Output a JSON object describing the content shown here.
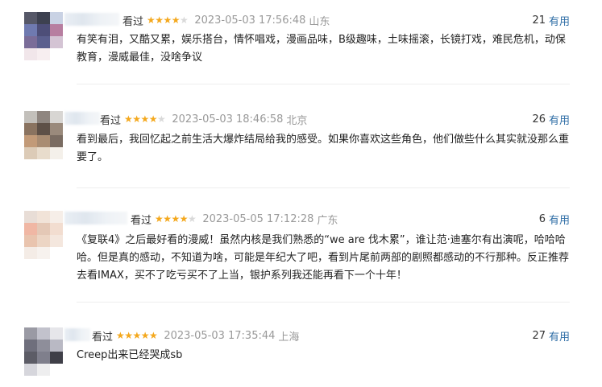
{
  "comments": [
    {
      "seen_label": "看过",
      "stars": 4,
      "time": "2023-05-03 17:56:48",
      "location": "山东",
      "useful_count": "21",
      "useful_label": "有用",
      "text": "有笑有泪，又酷又累，娱乐搭台，情怀唱戏，漫画品味，B级趣味，土味摇滚，长镜打戏，难民危机，动保教育，漫威最佳，没啥争议"
    },
    {
      "seen_label": "看过",
      "stars": 4,
      "time": "2023-05-03 18:46:58",
      "location": "北京",
      "useful_count": "26",
      "useful_label": "有用",
      "text": "看到最后，我回忆起之前生活大爆炸结局给我的感受。如果你喜欢这些角色，他们做些什么其实就没那么重要了。"
    },
    {
      "seen_label": "看过",
      "stars": 4,
      "time": "2023-05-05 17:12:28",
      "location": "广东",
      "useful_count": "6",
      "useful_label": "有用",
      "text": "《复联4》之后最好看的漫威！虽然内核是我们熟悉的“we are 伐木累”，谁让范·迪塞尔有出演呢，哈哈哈哈。但是真的感动，不知道为啥，可能是年纪大了吧，看到片尾前两部的剧照都感动的不行那种。反正推荐去看IMAX，买不了吃亏买不了上当，银护系列我还能再看下一个十年！"
    },
    {
      "seen_label": "看过",
      "stars": 5,
      "time": "2023-05-03 17:35:44",
      "location": "上海",
      "useful_count": "27",
      "useful_label": "有用",
      "text": "Creep出来已经哭成sb"
    }
  ],
  "colors": {
    "star": "#f4a81d",
    "star_off": "#d9d9d9",
    "useful_link": "#2f6ea6",
    "meta": "#999999"
  },
  "icons": {
    "star": "star-icon"
  }
}
